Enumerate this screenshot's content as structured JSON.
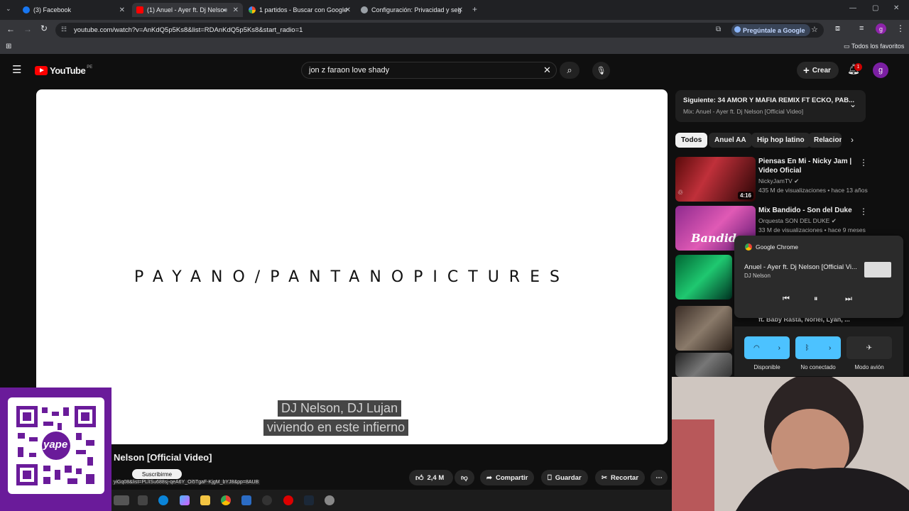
{
  "browser": {
    "tabs": [
      {
        "title": "(3) Facebook",
        "active": false
      },
      {
        "title": "(1) Anuel - Ayer ft. Dj Nelso",
        "active": true
      },
      {
        "title": "1 partidos - Buscar con Google",
        "active": false
      },
      {
        "title": "Configuración: Privacidad y seg",
        "active": false
      }
    ],
    "url": "youtube.com/watch?v=AnKdQ5p5Ks8&list=RDAnKdQ5p5Ks8&start_radio=1",
    "ask_google": "Pregúntale a Google",
    "bookmarks_all": "Todos los favoritos",
    "profile_initial": "g"
  },
  "youtube": {
    "logo": "YouTube",
    "region": "PE",
    "search_value": "jon z faraon love shady",
    "create_label": "Crear",
    "notifications_count": "1",
    "avatar_initial": "g"
  },
  "player": {
    "slate_text": "PAYANO/PANTANOPICTURES",
    "captions": [
      "DJ Nelson, DJ Lujan",
      "viviendo en este infierno"
    ]
  },
  "video": {
    "title_partial": "Nelson [Official Video]",
    "subscribe": "Suscribirme",
    "status_url": "yiGq08&list=PLlISu688sj-qeA6Y_Oi5TgaF-KjgM_bYJ8&pp=8AUB",
    "likes": "2,4 M",
    "share": "Compartir",
    "save": "Guardar",
    "clip": "Recortar"
  },
  "up_next": {
    "label": "Siguiente: 34 AMOR Y MAFIA REMIX FT ECKO, PAB...",
    "mix": "Mix: Anuel - Ayer ft. Dj Nelson [Official Video]"
  },
  "chips": [
    "Todos",
    "Anuel AA",
    "Hip hop latino",
    "Relacion"
  ],
  "recommendations": [
    {
      "title_line1": "Piensas En Mi - Nicky Jam |",
      "title_line2": "Video Oficial",
      "channel": "NickyJamTV",
      "meta": "435 M de visualizaciones • hace 13 años",
      "duration": "4:16"
    },
    {
      "title_line1": "Mix Bandido - Son del Duke",
      "title_line2": "",
      "channel": "Orquesta SON DEL DUKE",
      "meta": "33 M de visualizaciones • hace 9 meses",
      "duration": ""
    },
    {
      "title_line1": "ft. Baby Rasta, Noriel, Lyan, ...",
      "title_line2": "",
      "channel": "",
      "meta": "",
      "duration": ""
    }
  ],
  "media_popup": {
    "app": "Google Chrome",
    "title": "Anuel - Ayer ft. Dj Nelson [Official Vi...",
    "artist": "DJ Nelson"
  },
  "quick_settings": [
    {
      "label": "Disponible"
    },
    {
      "label": "No conectado"
    },
    {
      "label": "Modo avión"
    }
  ],
  "qr": {
    "brand": "yape"
  }
}
